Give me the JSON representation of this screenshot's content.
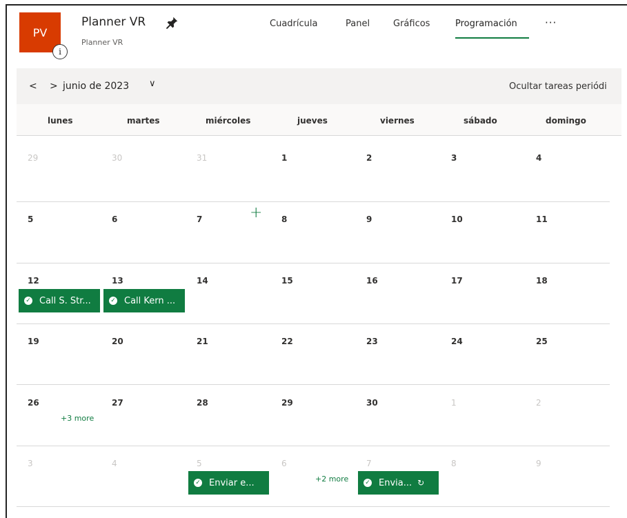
{
  "header": {
    "avatar_initials": "PV",
    "info_glyph": "i",
    "plan_title": "Planner VR",
    "plan_subtitle": "Planner VR",
    "nav_tabs": [
      {
        "label": "Cuadrícula"
      },
      {
        "label": "Panel"
      },
      {
        "label": "Gráficos"
      },
      {
        "label": "Programación",
        "active": true
      }
    ],
    "more_label": "···"
  },
  "toolbar": {
    "prev_glyph": "<",
    "next_glyph": ">",
    "month_label": "junio de 2023",
    "dropdown_glyph": "∨",
    "hide_tasks_label": "Ocultar tareas periódi"
  },
  "calendar": {
    "day_names": [
      "lunes",
      "martes",
      "miércoles",
      "jueves",
      "viernes",
      "sábado",
      "domingo"
    ],
    "weeks": [
      [
        "29",
        "30",
        "31",
        "1",
        "2",
        "3",
        "4"
      ],
      [
        "5",
        "6",
        "7",
        "8",
        "9",
        "10",
        "11"
      ],
      [
        "12",
        "13",
        "14",
        "15",
        "16",
        "17",
        "18"
      ],
      [
        "19",
        "20",
        "21",
        "22",
        "23",
        "24",
        "25"
      ],
      [
        "26",
        "27",
        "28",
        "29",
        "30",
        "1",
        "2"
      ],
      [
        "3",
        "4",
        "5",
        "6",
        "7",
        "8",
        "9"
      ]
    ],
    "add_glyph": "+",
    "tasks": {
      "t1": "Call S. Str...",
      "t2": "Call Kern ...",
      "t3": "Enviar e...",
      "t4": "Envia..."
    },
    "check_glyph": "✓",
    "repeat_glyph": "↻",
    "more_week5": "+3 more",
    "more_week6": "+2 more"
  },
  "colors": {
    "accent": "#107c41",
    "avatar": "#d83b01",
    "toolbar_bg": "#f3f2f1"
  }
}
